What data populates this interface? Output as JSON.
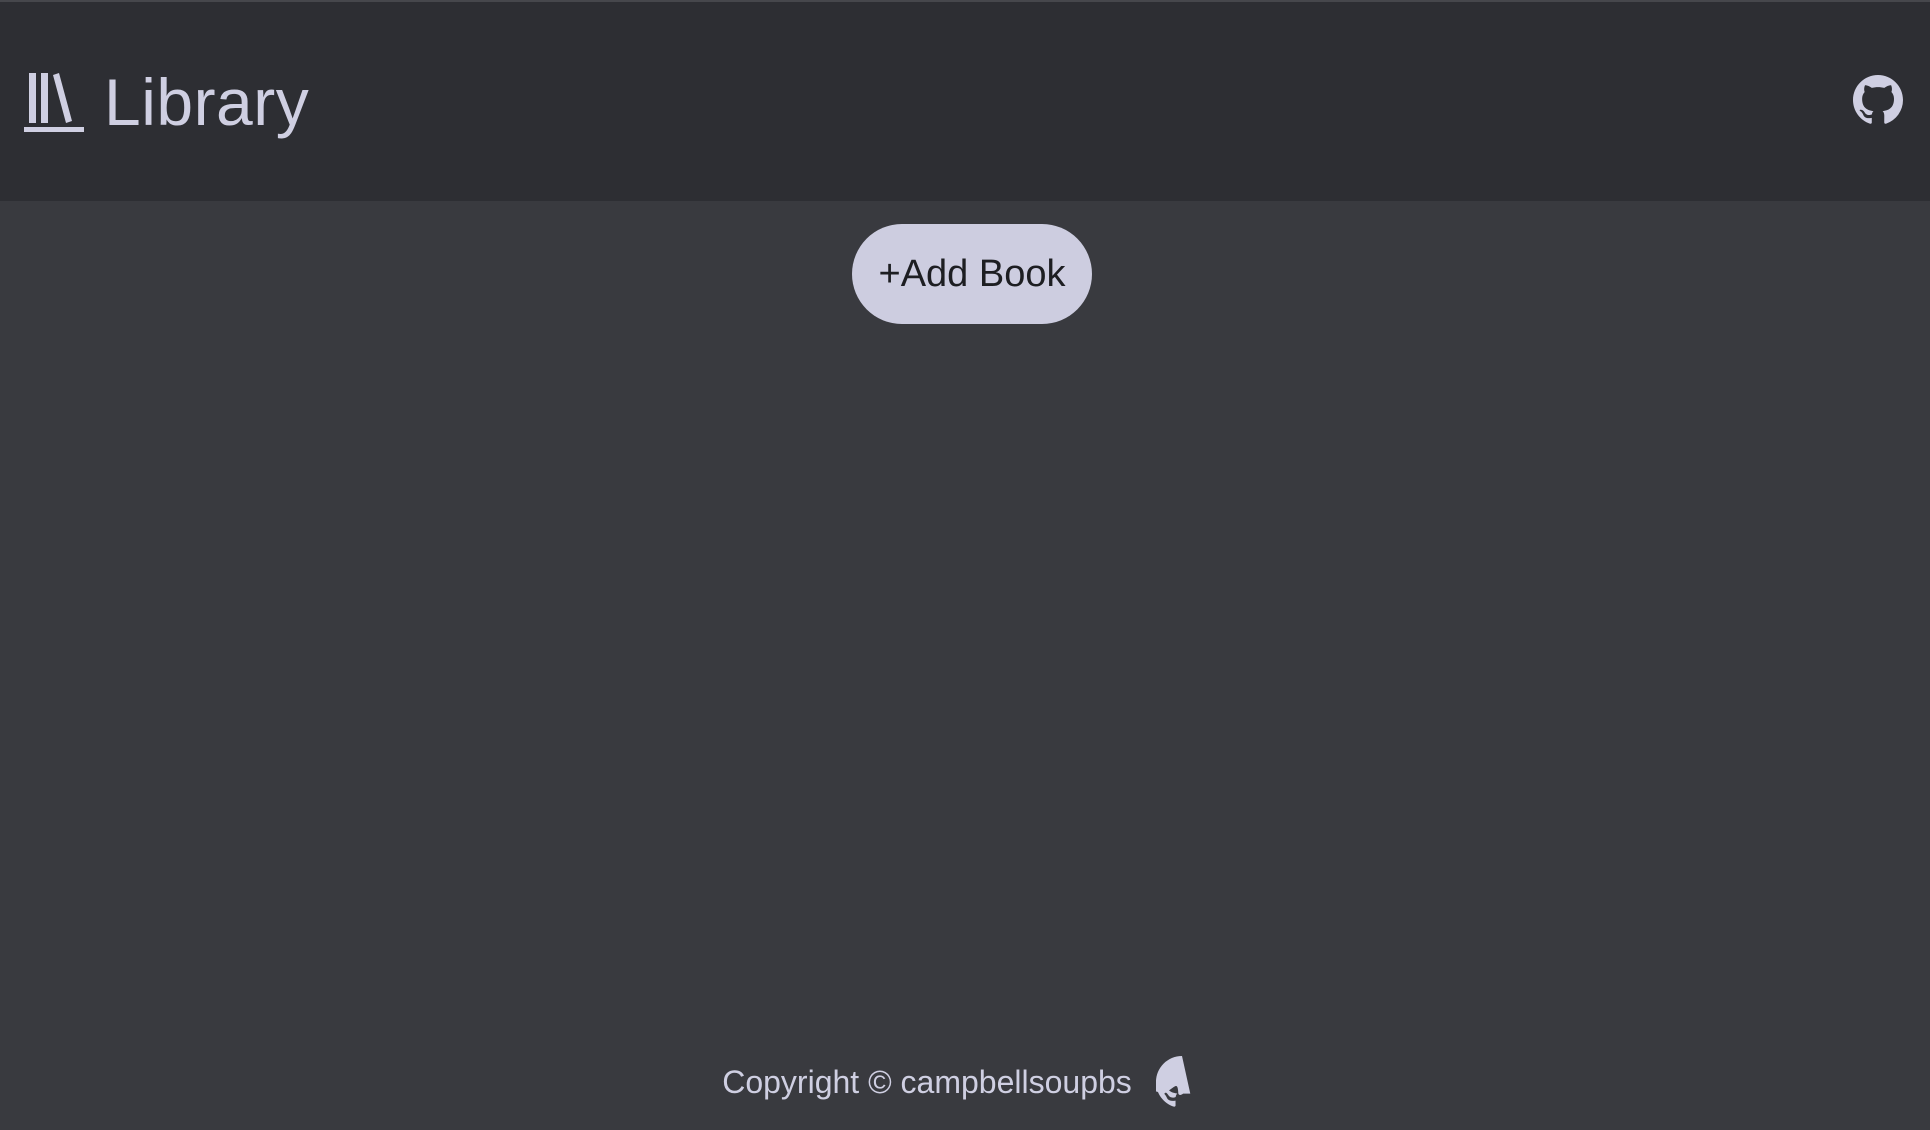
{
  "header": {
    "title": "Library",
    "logo_icon": "books-icon",
    "github_icon": "github-icon"
  },
  "main": {
    "add_book_label": "+Add Book"
  },
  "footer": {
    "copyright_text": "Copyright © campbellsoupbs",
    "github_icon": "github-icon"
  },
  "colors": {
    "page_background": "#393a3f",
    "header_background": "#2d2e33",
    "accent_text": "#cfcfe2",
    "button_background": "#cdcde0",
    "button_text": "#1d1e22"
  }
}
